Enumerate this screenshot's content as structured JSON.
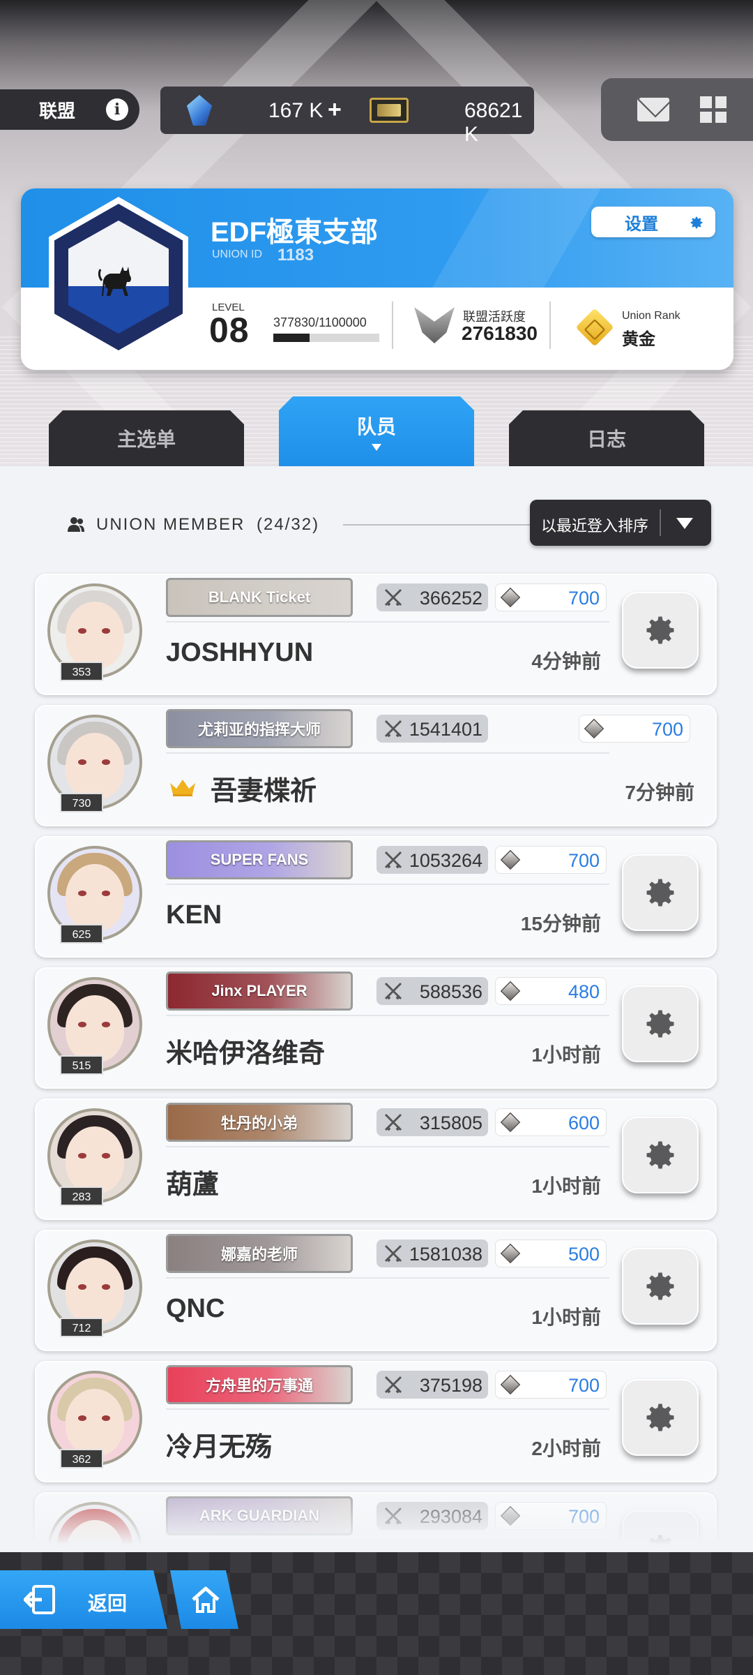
{
  "topbar": {
    "title": "联盟",
    "info_icon": "info-icon",
    "gems": "167 K",
    "gems_plus": "+",
    "tickets": "68621 K"
  },
  "union": {
    "name": "EDF極東支部",
    "id_label": "UNION ID",
    "id": "1183",
    "settings_label": "设置",
    "level_label": "LEVEL",
    "level": "08",
    "exp_text": "377830/1100000",
    "exp_fraction": 0.3435,
    "activity_label": "联盟活跃度",
    "activity": "2761830",
    "rank_label": "Union Rank",
    "rank": "黄金"
  },
  "tabs": [
    {
      "label": "主选单"
    },
    {
      "label": "队员"
    },
    {
      "label": "日志"
    }
  ],
  "members_header": {
    "label": "UNION MEMBER",
    "count": "(24/32)",
    "sort_label": "以最近登入排序"
  },
  "members": [
    {
      "name": "JOSHHYUN",
      "level": "353",
      "title": "BLANK Ticket",
      "power": "366252",
      "points": "700",
      "time": "4分钟前",
      "has_gear": true,
      "title_color": "#c9c3bb",
      "hair": "#d9d5d2"
    },
    {
      "name": "吾妻楪祈",
      "level": "730",
      "title": "尤莉亚的指挥大师",
      "power": "1541401",
      "points": "700",
      "time": "7分钟前",
      "has_gear": false,
      "title_color": "#8b8fa0",
      "hair": "#c9c6c4"
    },
    {
      "name": "KEN",
      "level": "625",
      "title": "SUPER FANS",
      "power": "1053264",
      "points": "700",
      "time": "15分钟前",
      "has_gear": true,
      "title_color": "#9d8fe0",
      "hair": "#c8a87c"
    },
    {
      "name": "米哈伊洛维奇",
      "level": "515",
      "title": "Jinx PLAYER",
      "power": "588536",
      "points": "480",
      "time": "1小时前",
      "has_gear": true,
      "title_color": "#8c2830",
      "hair": "#2d2422"
    },
    {
      "name": "葫蘆",
      "level": "283",
      "title": "牡丹的小弟",
      "power": "315805",
      "points": "600",
      "time": "1小时前",
      "has_gear": true,
      "title_color": "#9a6a48",
      "hair": "#2b2224"
    },
    {
      "name": "QNC",
      "level": "712",
      "title": "娜嘉的老师",
      "power": "1581038",
      "points": "500",
      "time": "1小时前",
      "has_gear": true,
      "title_color": "#8a8080",
      "hair": "#2a1f1e"
    },
    {
      "name": "冷月无殇",
      "level": "362",
      "title": "方舟里的万事通",
      "power": "375198",
      "points": "700",
      "time": "2小时前",
      "has_gear": true,
      "title_color": "#e8415a",
      "hair": "#d8c9a8"
    },
    {
      "name": "",
      "level": "",
      "title": "ARK GUARDIAN",
      "power": "293084",
      "points": "700",
      "time": "",
      "has_gear": true,
      "title_color": "#b7aac9",
      "hair": "#c04040"
    }
  ],
  "bottom": {
    "back_label": "返回"
  },
  "colors": {
    "accent": "#1f8fe8",
    "dark": "#2e2d31",
    "points_text": "#2a7de0"
  }
}
